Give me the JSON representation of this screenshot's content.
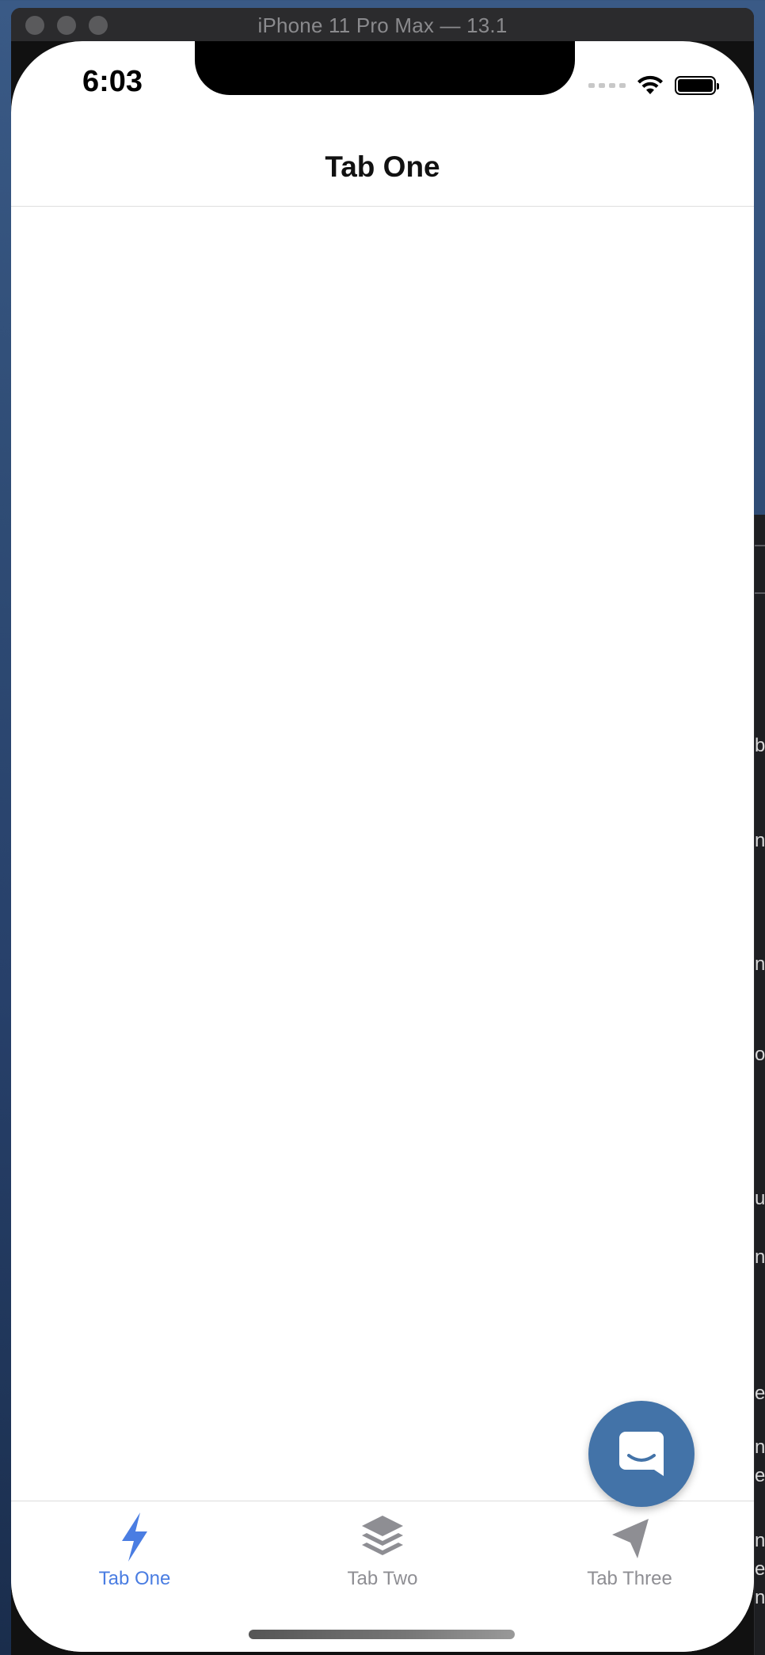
{
  "window": {
    "title": "iPhone 11 Pro Max — 13.1"
  },
  "status_bar": {
    "time": "6:03",
    "icons": [
      "cellular-signal-icon",
      "wifi-icon",
      "battery-icon"
    ]
  },
  "nav": {
    "title": "Tab One"
  },
  "tabs": [
    {
      "label": "Tab One",
      "icon": "lightning-icon",
      "active": true
    },
    {
      "label": "Tab Two",
      "icon": "layers-icon",
      "active": false
    },
    {
      "label": "Tab Three",
      "icon": "send-icon",
      "active": false
    }
  ],
  "chat_button": {
    "icon": "chat-icon"
  },
  "colors": {
    "accent": "#4a7de2",
    "tab_inactive": "#8e8e93",
    "chat_button": "#4373a8",
    "desktop": "#2f4c75"
  },
  "background_app": {
    "fragments": [
      "b",
      "n",
      "n",
      "o",
      "u",
      "n",
      "e",
      "n",
      "e",
      "n",
      "e",
      "n"
    ]
  }
}
